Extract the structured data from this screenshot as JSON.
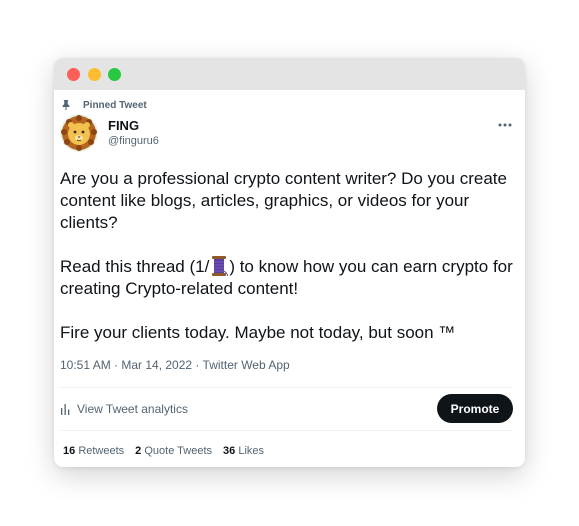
{
  "window": {
    "controls": [
      "close",
      "minimize",
      "maximize"
    ],
    "colors": {
      "close": "#fe5f57",
      "minimize": "#febc2e",
      "maximize": "#28c840"
    }
  },
  "tweet": {
    "pinned_label": "Pinned Tweet",
    "author": {
      "name": "FING",
      "handle": "@finguru6",
      "avatar_icon": "lion-avatar"
    },
    "more_icon": "more-dots-icon",
    "text": {
      "paragraph1": "Are you a professional crypto content writer? Do you create content like blogs, articles, graphics, or videos for your clients?",
      "paragraph2_before": "Read this thread (1/",
      "paragraph2_emoji": "spool-of-thread-emoji",
      "paragraph2_after": ") to know how you can earn crypto for creating Crypto-related content!",
      "paragraph3": "Fire your clients today. Maybe not today, but soon ™"
    },
    "meta": "10:51 AM · Mar 14, 2022 · Twitter Web App",
    "analytics_label": "View Tweet analytics",
    "promote_label": "Promote",
    "stats": {
      "retweets_count": "16",
      "retweets_label": "Retweets",
      "quotes_count": "2",
      "quotes_label": "Quote Tweets",
      "likes_count": "36",
      "likes_label": "Likes"
    }
  }
}
